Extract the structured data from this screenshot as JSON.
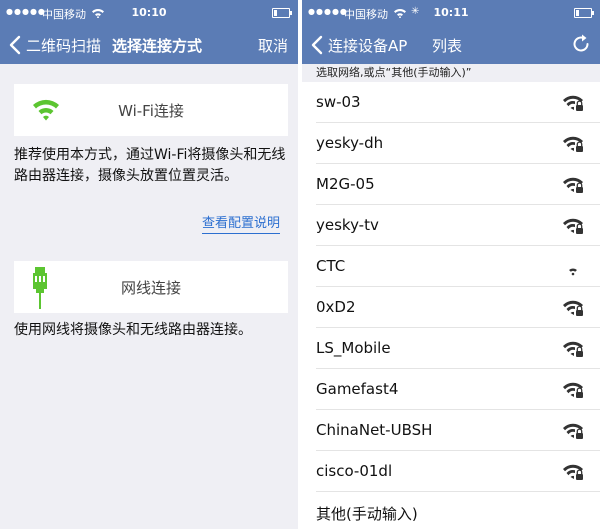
{
  "status_left": {
    "carrier": "中国移动",
    "time": "10:10"
  },
  "status_right": {
    "carrier": "中国移动",
    "time": "10:11"
  },
  "left_screen": {
    "nav": {
      "back_label": "二维码扫描",
      "title": "选择连接方式",
      "cancel_label": "取消"
    },
    "wifi_option": {
      "label": "Wi-Fi连接",
      "description": "推荐使用本方式，通过Wi-Fi将摄像头和无线路由器连接，摄像头放置位置灵活。",
      "link": "查看配置说明"
    },
    "wired_option": {
      "label": "网线连接",
      "description": "使用网线将摄像头和无线路由器连接。"
    }
  },
  "right_screen": {
    "nav": {
      "back_label": "连接设备AP",
      "title": "列表"
    },
    "hint": "选取网络,或点“其他(手动输入)”",
    "networks": [
      {
        "name": "sw-03",
        "locked": true
      },
      {
        "name": "yesky-dh",
        "locked": true
      },
      {
        "name": "M2G-05",
        "locked": true
      },
      {
        "name": "yesky-tv",
        "locked": true
      },
      {
        "name": "CTC",
        "locked": false
      },
      {
        "name": "0xD2",
        "locked": true
      },
      {
        "name": "LS_Mobile",
        "locked": true
      },
      {
        "name": "Gamefast4",
        "locked": true
      },
      {
        "name": "ChinaNet-UBSH",
        "locked": true
      },
      {
        "name": "cisco-01dl",
        "locked": true
      }
    ],
    "other_label": "其他(手动输入)"
  },
  "colors": {
    "nav_bg": "#5b7cb5",
    "wifi_green": "#5cc531",
    "link_blue": "#2c6fd0"
  }
}
